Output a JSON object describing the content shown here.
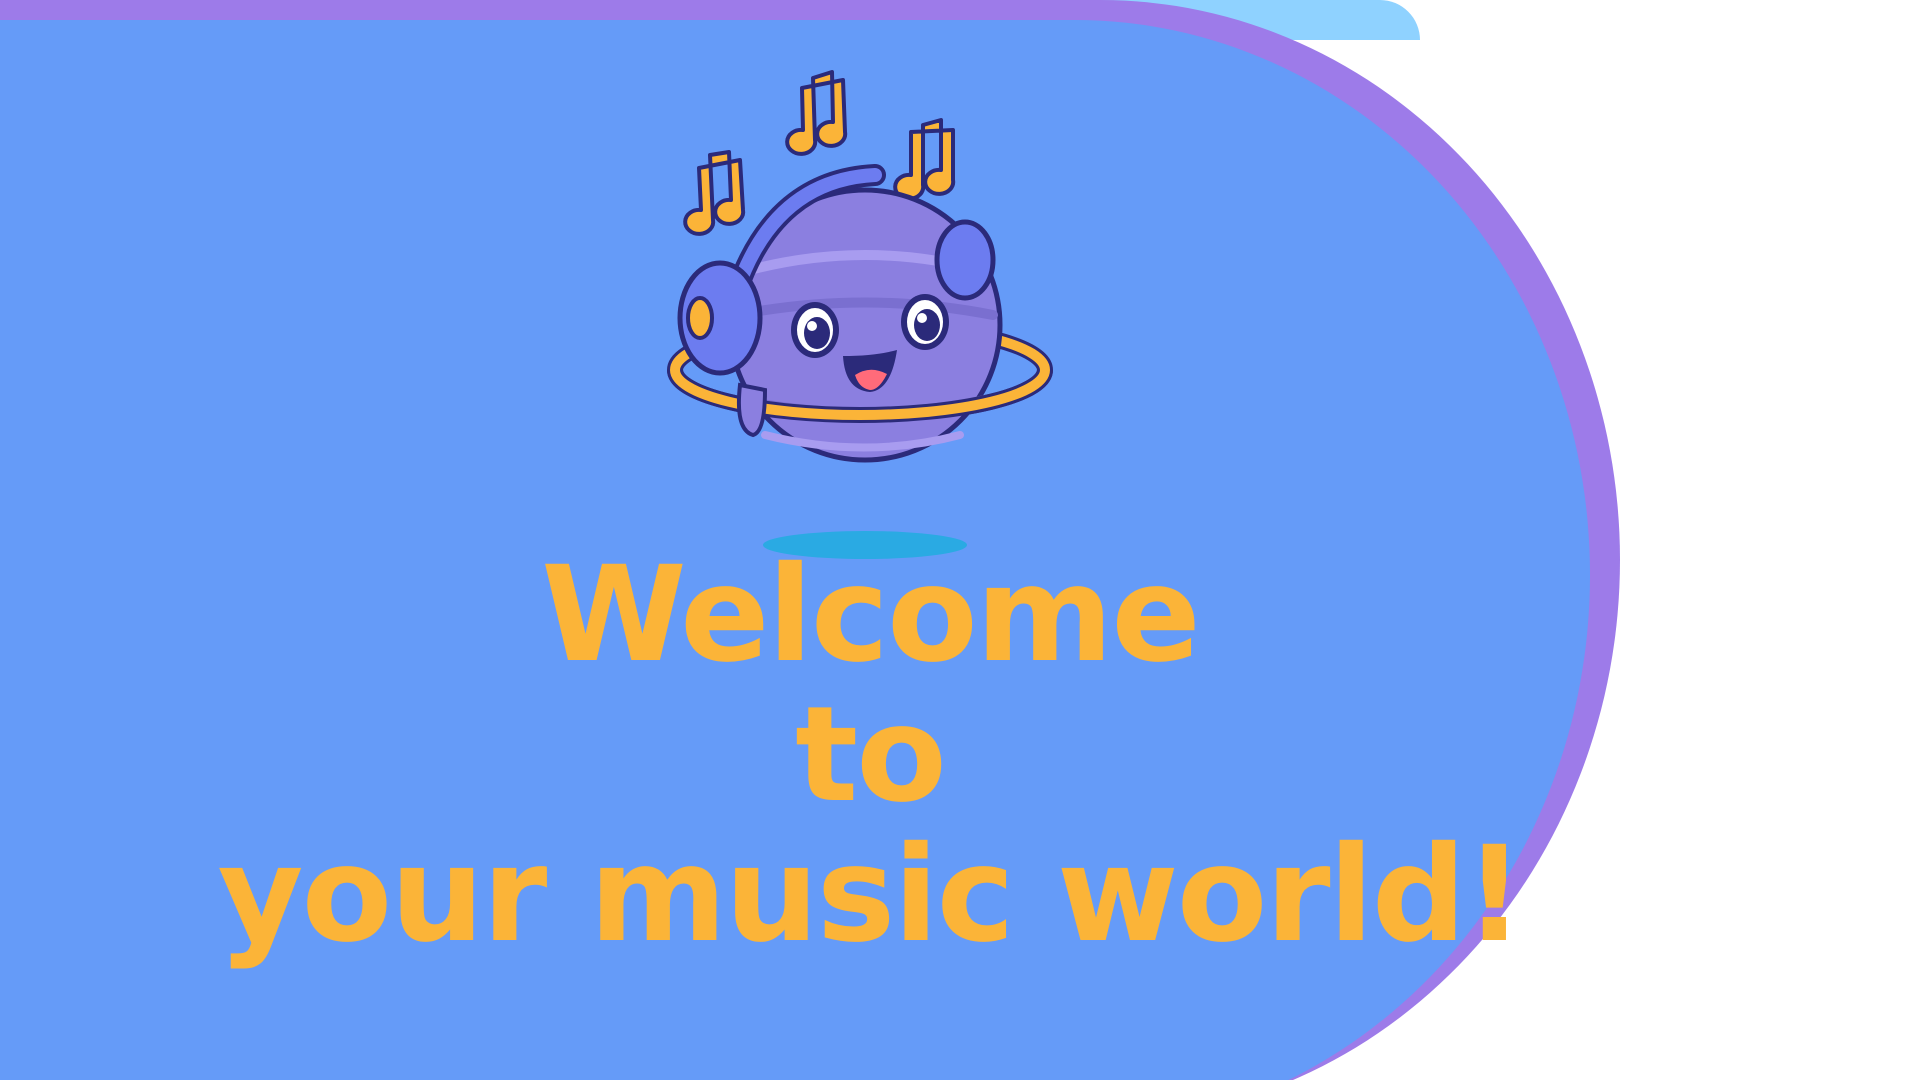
{
  "welcome": {
    "line1": "Welcome",
    "line2": "to",
    "line3": "your music world!"
  },
  "mascot": {
    "icon": "planet-with-headphones-icon",
    "notes_icon": "music-note-icon"
  },
  "colors": {
    "background": "#ffffff",
    "panel": "#659bf8",
    "panel_edge": "#9d7be9",
    "top_strip": "#8fd2ff",
    "text": "#fbb438",
    "planet": "#8b7fe0",
    "ring": "#fbb438"
  }
}
